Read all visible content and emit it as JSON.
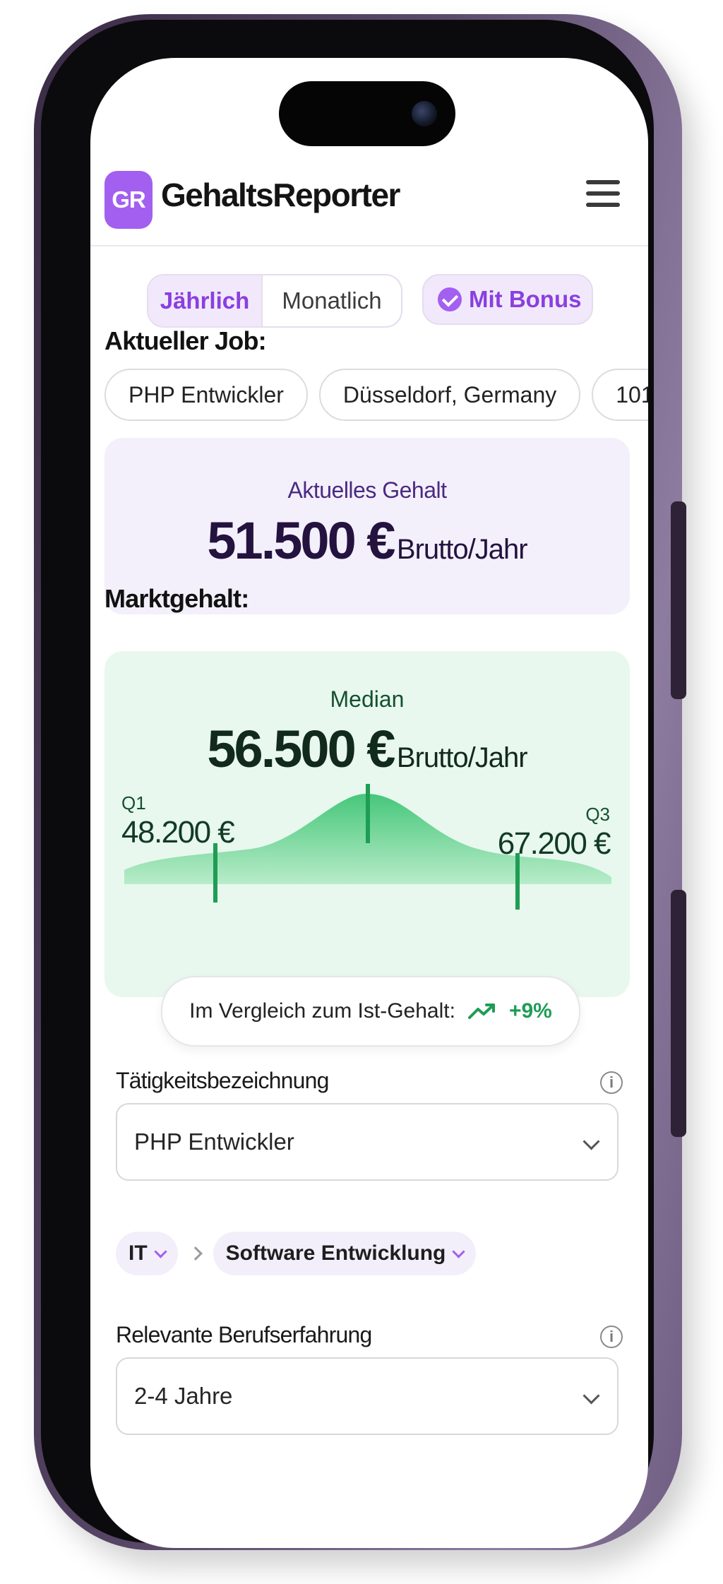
{
  "header": {
    "logo_text": "GR",
    "brand": "GehaltsReporter",
    "menu_icon": "hamburger-menu-icon",
    "accent_color": "#a35ff0"
  },
  "toggles": {
    "yearly": "Jährlich",
    "monthly": "Monatlich",
    "yearly_selected": true,
    "bonus": "Mit Bonus",
    "bonus_checked": true
  },
  "current_job": {
    "title": "Aktueller Job:",
    "chips": [
      "PHP Entwickler",
      "Düsseldorf, Germany",
      "101"
    ]
  },
  "current_salary": {
    "label": "Aktuelles Gehalt",
    "value": "51.500 €",
    "unit": "Brutto/Jahr"
  },
  "market": {
    "title": "Marktgehalt:",
    "median_label": "Median",
    "median_value": "56.500 €",
    "unit": "Brutto/Jahr",
    "q1_label": "Q1",
    "q1_value": "48.200 €",
    "q3_label": "Q3",
    "q3_value": "67.200 €",
    "compare_label": "Im Vergleich zum Ist-Gehalt:",
    "compare_value": "+9%",
    "positive_color": "#1f9d55"
  },
  "form": {
    "job_title_label": "Tätigkeitsbezeichnung",
    "job_title_value": "PHP Entwickler",
    "category": "IT",
    "subcategory": "Software Entwicklung",
    "experience_label": "Relevante Berufserfahrung",
    "experience_value": "2-4 Jahre"
  }
}
